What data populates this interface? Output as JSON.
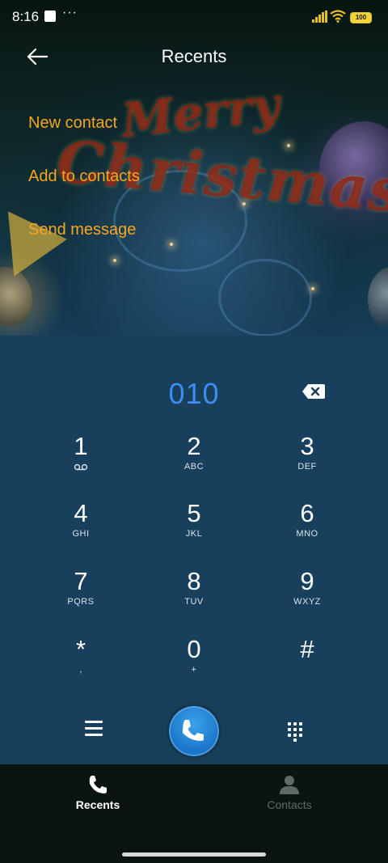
{
  "status_bar": {
    "time": "8:16",
    "more": "···",
    "battery": "100"
  },
  "header": {
    "title": "Recents"
  },
  "background_text": [
    "Merry",
    "Christmas"
  ],
  "menu": [
    {
      "label": "New contact"
    },
    {
      "label": "Add to contacts"
    },
    {
      "label": "Send message"
    }
  ],
  "dialpad": {
    "number": "010",
    "keys": [
      {
        "digit": "1",
        "letters": ""
      },
      {
        "digit": "2",
        "letters": "ABC"
      },
      {
        "digit": "3",
        "letters": "DEF"
      },
      {
        "digit": "4",
        "letters": "GHI"
      },
      {
        "digit": "5",
        "letters": "JKL"
      },
      {
        "digit": "6",
        "letters": "MNO"
      },
      {
        "digit": "7",
        "letters": "PQRS"
      },
      {
        "digit": "8",
        "letters": "TUV"
      },
      {
        "digit": "9",
        "letters": "WXYZ"
      },
      {
        "digit": "*",
        "letters": ","
      },
      {
        "digit": "0",
        "letters": "+"
      },
      {
        "digit": "#",
        "letters": ""
      }
    ]
  },
  "bottom_nav": [
    {
      "label": "Recents",
      "icon": "phone-icon",
      "active": true
    },
    {
      "label": "Contacts",
      "icon": "person-icon",
      "active": false
    }
  ],
  "colors": {
    "accent": "#f5a623",
    "number": "#3e8df2",
    "pad": "#183f5c",
    "call": "#1a73c8"
  }
}
